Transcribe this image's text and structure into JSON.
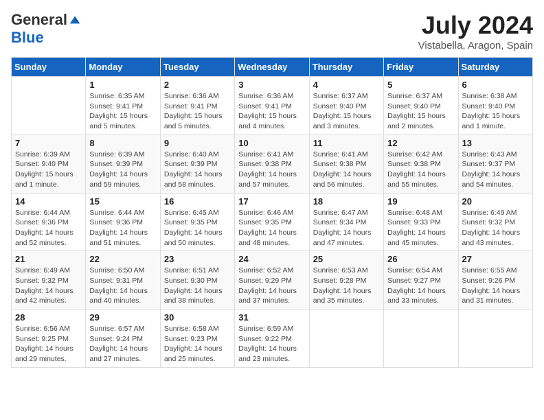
{
  "logo": {
    "general": "General",
    "blue": "Blue"
  },
  "title": {
    "month_year": "July 2024",
    "location": "Vistabella, Aragon, Spain"
  },
  "days_of_week": [
    "Sunday",
    "Monday",
    "Tuesday",
    "Wednesday",
    "Thursday",
    "Friday",
    "Saturday"
  ],
  "weeks": [
    [
      {
        "day": "",
        "info": ""
      },
      {
        "day": "1",
        "info": "Sunrise: 6:35 AM\nSunset: 9:41 PM\nDaylight: 15 hours\nand 5 minutes."
      },
      {
        "day": "2",
        "info": "Sunrise: 6:36 AM\nSunset: 9:41 PM\nDaylight: 15 hours\nand 5 minutes."
      },
      {
        "day": "3",
        "info": "Sunrise: 6:36 AM\nSunset: 9:41 PM\nDaylight: 15 hours\nand 4 minutes."
      },
      {
        "day": "4",
        "info": "Sunrise: 6:37 AM\nSunset: 9:40 PM\nDaylight: 15 hours\nand 3 minutes."
      },
      {
        "day": "5",
        "info": "Sunrise: 6:37 AM\nSunset: 9:40 PM\nDaylight: 15 hours\nand 2 minutes."
      },
      {
        "day": "6",
        "info": "Sunrise: 6:38 AM\nSunset: 9:40 PM\nDaylight: 15 hours\nand 1 minute."
      }
    ],
    [
      {
        "day": "7",
        "info": "Sunrise: 6:39 AM\nSunset: 9:40 PM\nDaylight: 15 hours\nand 1 minute."
      },
      {
        "day": "8",
        "info": "Sunrise: 6:39 AM\nSunset: 9:39 PM\nDaylight: 14 hours\nand 59 minutes."
      },
      {
        "day": "9",
        "info": "Sunrise: 6:40 AM\nSunset: 9:39 PM\nDaylight: 14 hours\nand 58 minutes."
      },
      {
        "day": "10",
        "info": "Sunrise: 6:41 AM\nSunset: 9:38 PM\nDaylight: 14 hours\nand 57 minutes."
      },
      {
        "day": "11",
        "info": "Sunrise: 6:41 AM\nSunset: 9:38 PM\nDaylight: 14 hours\nand 56 minutes."
      },
      {
        "day": "12",
        "info": "Sunrise: 6:42 AM\nSunset: 9:38 PM\nDaylight: 14 hours\nand 55 minutes."
      },
      {
        "day": "13",
        "info": "Sunrise: 6:43 AM\nSunset: 9:37 PM\nDaylight: 14 hours\nand 54 minutes."
      }
    ],
    [
      {
        "day": "14",
        "info": "Sunrise: 6:44 AM\nSunset: 9:36 PM\nDaylight: 14 hours\nand 52 minutes."
      },
      {
        "day": "15",
        "info": "Sunrise: 6:44 AM\nSunset: 9:36 PM\nDaylight: 14 hours\nand 51 minutes."
      },
      {
        "day": "16",
        "info": "Sunrise: 6:45 AM\nSunset: 9:35 PM\nDaylight: 14 hours\nand 50 minutes."
      },
      {
        "day": "17",
        "info": "Sunrise: 6:46 AM\nSunset: 9:35 PM\nDaylight: 14 hours\nand 48 minutes."
      },
      {
        "day": "18",
        "info": "Sunrise: 6:47 AM\nSunset: 9:34 PM\nDaylight: 14 hours\nand 47 minutes."
      },
      {
        "day": "19",
        "info": "Sunrise: 6:48 AM\nSunset: 9:33 PM\nDaylight: 14 hours\nand 45 minutes."
      },
      {
        "day": "20",
        "info": "Sunrise: 6:49 AM\nSunset: 9:32 PM\nDaylight: 14 hours\nand 43 minutes."
      }
    ],
    [
      {
        "day": "21",
        "info": "Sunrise: 6:49 AM\nSunset: 9:32 PM\nDaylight: 14 hours\nand 42 minutes."
      },
      {
        "day": "22",
        "info": "Sunrise: 6:50 AM\nSunset: 9:31 PM\nDaylight: 14 hours\nand 40 minutes."
      },
      {
        "day": "23",
        "info": "Sunrise: 6:51 AM\nSunset: 9:30 PM\nDaylight: 14 hours\nand 38 minutes."
      },
      {
        "day": "24",
        "info": "Sunrise: 6:52 AM\nSunset: 9:29 PM\nDaylight: 14 hours\nand 37 minutes."
      },
      {
        "day": "25",
        "info": "Sunrise: 6:53 AM\nSunset: 9:28 PM\nDaylight: 14 hours\nand 35 minutes."
      },
      {
        "day": "26",
        "info": "Sunrise: 6:54 AM\nSunset: 9:27 PM\nDaylight: 14 hours\nand 33 minutes."
      },
      {
        "day": "27",
        "info": "Sunrise: 6:55 AM\nSunset: 9:26 PM\nDaylight: 14 hours\nand 31 minutes."
      }
    ],
    [
      {
        "day": "28",
        "info": "Sunrise: 6:56 AM\nSunset: 9:25 PM\nDaylight: 14 hours\nand 29 minutes."
      },
      {
        "day": "29",
        "info": "Sunrise: 6:57 AM\nSunset: 9:24 PM\nDaylight: 14 hours\nand 27 minutes."
      },
      {
        "day": "30",
        "info": "Sunrise: 6:58 AM\nSunset: 9:23 PM\nDaylight: 14 hours\nand 25 minutes."
      },
      {
        "day": "31",
        "info": "Sunrise: 6:59 AM\nSunset: 9:22 PM\nDaylight: 14 hours\nand 23 minutes."
      },
      {
        "day": "",
        "info": ""
      },
      {
        "day": "",
        "info": ""
      },
      {
        "day": "",
        "info": ""
      }
    ]
  ]
}
